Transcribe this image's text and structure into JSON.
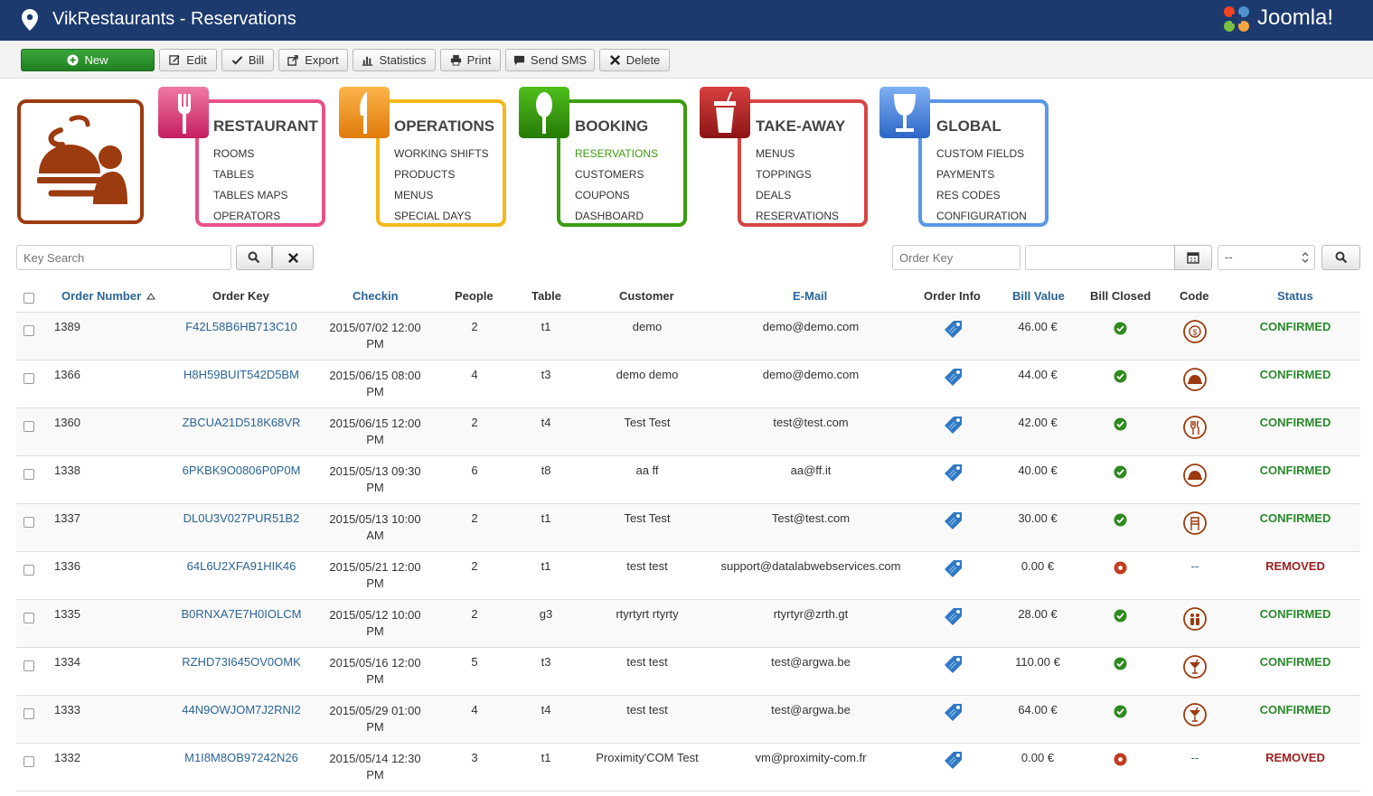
{
  "header": {
    "title": "VikRestaurants - Reservations",
    "brand": "Joomla!"
  },
  "toolbar": {
    "new": "New",
    "edit": "Edit",
    "bill": "Bill",
    "export": "Export",
    "statistics": "Statistics",
    "print": "Print",
    "send_sms": "Send SMS",
    "delete": "Delete"
  },
  "menus": [
    {
      "head": "RESTAURANT",
      "items": [
        "ROOMS",
        "TABLES",
        "TABLES MAPS",
        "OPERATORS"
      ],
      "color": "#e9508a"
    },
    {
      "head": "OPERATIONS",
      "items": [
        "WORKING SHIFTS",
        "PRODUCTS",
        "MENUS",
        "SPECIAL DAYS"
      ],
      "color": "#f3b81b"
    },
    {
      "head": "BOOKING",
      "items": [
        "RESERVATIONS",
        "CUSTOMERS",
        "COUPONS",
        "DASHBOARD"
      ],
      "color": "#3a9c0f",
      "active_index": 0
    },
    {
      "head": "TAKE-AWAY",
      "items": [
        "MENUS",
        "TOPPINGS",
        "DEALS",
        "RESERVATIONS"
      ],
      "color": "#d64545"
    },
    {
      "head": "GLOBAL",
      "items": [
        "CUSTOM FIELDS",
        "PAYMENTS",
        "RES CODES",
        "CONFIGURATION"
      ],
      "color": "#5a97e8"
    }
  ],
  "filters": {
    "key_search_placeholder": "Key Search",
    "order_key_placeholder": "Order Key",
    "date_value": "",
    "select_value": "--"
  },
  "table": {
    "headers": [
      "Order Number",
      "Order Key",
      "Checkin",
      "People",
      "Table",
      "Customer",
      "E-Mail",
      "Order Info",
      "Bill Value",
      "Bill Closed",
      "Code",
      "Status"
    ],
    "rows": [
      {
        "num": "1389",
        "key": "F42L58B6HB713C10",
        "d1": "2015/07/02 12:00",
        "d2": "PM",
        "people": "2",
        "table": "t1",
        "customer": "demo",
        "email": "demo@demo.com",
        "bill": "46.00 €",
        "closed": true,
        "code": "dollar",
        "status": "CONFIRMED"
      },
      {
        "num": "1366",
        "key": "H8H59BUIT542D5BM",
        "d1": "2015/06/15 08:00",
        "d2": "PM",
        "people": "4",
        "table": "t3",
        "customer": "demo demo",
        "email": "demo@demo.com",
        "bill": "44.00 €",
        "closed": true,
        "code": "cloche",
        "status": "CONFIRMED"
      },
      {
        "num": "1360",
        "key": "ZBCUA21D518K68VR",
        "d1": "2015/06/15 12:00",
        "d2": "PM",
        "people": "2",
        "table": "t4",
        "customer": "Test Test",
        "email": "test@test.com",
        "bill": "42.00 €",
        "closed": true,
        "code": "cutlery",
        "status": "CONFIRMED"
      },
      {
        "num": "1338",
        "key": "6PKBK9O0806P0P0M",
        "d1": "2015/05/13 09:30",
        "d2": "PM",
        "people": "6",
        "table": "t8",
        "customer": "aa ff",
        "email": "aa@ff.it",
        "bill": "40.00 €",
        "closed": true,
        "code": "cloche",
        "status": "CONFIRMED"
      },
      {
        "num": "1337",
        "key": "DL0U3V027PUR51B2",
        "d1": "2015/05/13 10:00",
        "d2": "AM",
        "people": "2",
        "table": "t1",
        "customer": "Test Test",
        "email": "Test@test.com",
        "bill": "30.00 €",
        "closed": true,
        "code": "chair",
        "status": "CONFIRMED"
      },
      {
        "num": "1336",
        "key": "64L6U2XFA91HIK46",
        "d1": "2015/05/21 12:00",
        "d2": "PM",
        "people": "2",
        "table": "t1",
        "customer": "test test",
        "email": "support@datalabwebservices.com",
        "bill": "0.00 €",
        "closed": false,
        "code": "--",
        "status": "REMOVED"
      },
      {
        "num": "1335",
        "key": "B0RNXA7E7H0IOLCM",
        "d1": "2015/05/12 10:00",
        "d2": "PM",
        "people": "2",
        "table": "g3",
        "customer": "rtyrtyrt rtyrty",
        "email": "rtyrtyr@zrth.gt",
        "bill": "28.00 €",
        "closed": true,
        "code": "people",
        "status": "CONFIRMED"
      },
      {
        "num": "1334",
        "key": "RZHD73I645OV0OMK",
        "d1": "2015/05/16 12:00",
        "d2": "PM",
        "people": "5",
        "table": "t3",
        "customer": "test test",
        "email": "test@argwa.be",
        "bill": "110.00 €",
        "closed": true,
        "code": "cocktail",
        "status": "CONFIRMED"
      },
      {
        "num": "1333",
        "key": "44N9OWJOM7J2RNI2",
        "d1": "2015/05/29 01:00",
        "d2": "PM",
        "people": "4",
        "table": "t4",
        "customer": "test test",
        "email": "test@argwa.be",
        "bill": "64.00 €",
        "closed": true,
        "code": "cocktail",
        "status": "CONFIRMED"
      },
      {
        "num": "1332",
        "key": "M1I8M8OB97242N26",
        "d1": "2015/05/14 12:30",
        "d2": "PM",
        "people": "3",
        "table": "t1",
        "customer": "Proximity'COM Test",
        "email": "vm@proximity-com.fr",
        "bill": "0.00 €",
        "closed": false,
        "code": "--",
        "status": "REMOVED"
      }
    ]
  }
}
